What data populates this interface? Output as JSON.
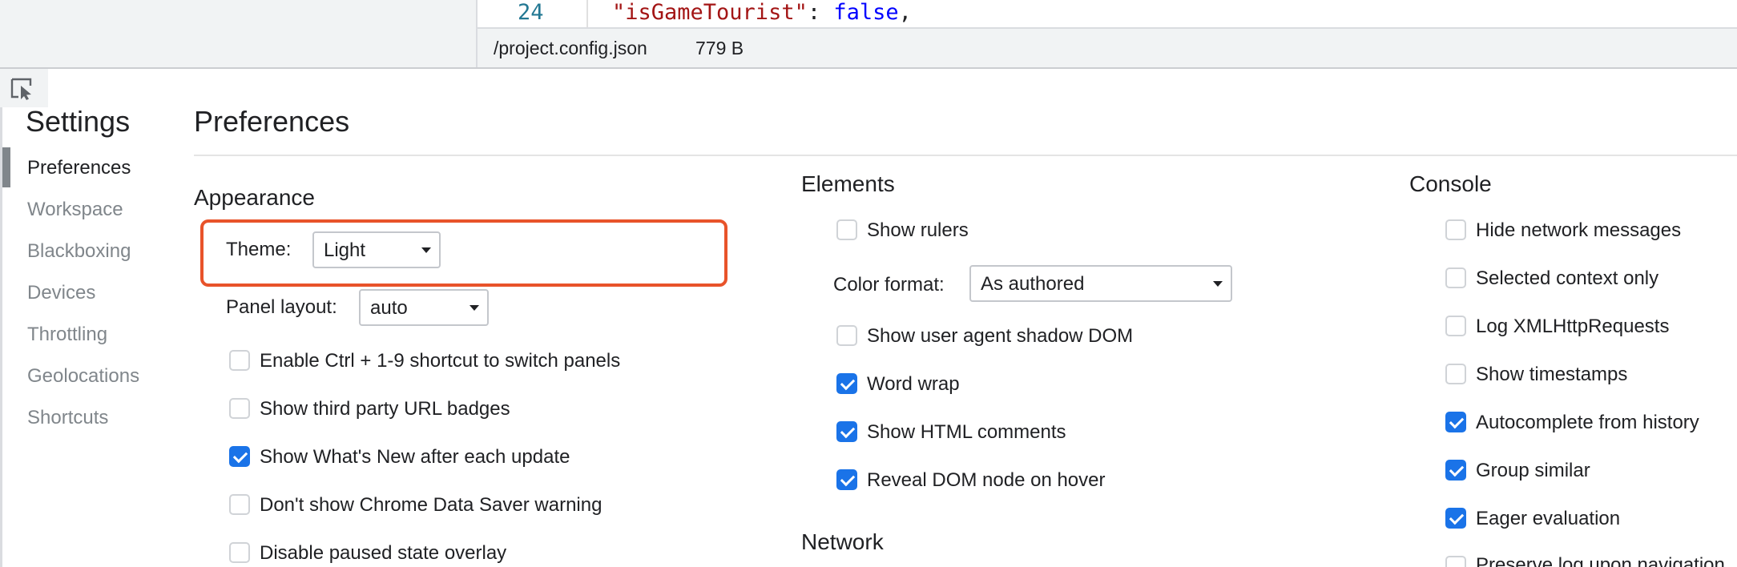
{
  "editor": {
    "line_number": "24",
    "code_key": "\"isGameTourist\"",
    "code_colon": ": ",
    "code_value": "false",
    "code_comma": ",",
    "file_path": "/project.config.json",
    "file_size": "779 B"
  },
  "sidebar": {
    "title": "Settings",
    "items": [
      {
        "label": "Preferences",
        "active": true
      },
      {
        "label": "Workspace",
        "active": false
      },
      {
        "label": "Blackboxing",
        "active": false
      },
      {
        "label": "Devices",
        "active": false
      },
      {
        "label": "Throttling",
        "active": false
      },
      {
        "label": "Geolocations",
        "active": false
      },
      {
        "label": "Shortcuts",
        "active": false
      }
    ]
  },
  "main": {
    "title": "Preferences",
    "appearance": {
      "title": "Appearance",
      "theme_label": "Theme:",
      "theme_value": "Light",
      "panel_layout_label": "Panel layout:",
      "panel_layout_value": "auto",
      "checkboxes": [
        {
          "label": "Enable Ctrl + 1-9 shortcut to switch panels",
          "checked": false
        },
        {
          "label": "Show third party URL badges",
          "checked": false
        },
        {
          "label": "Show What's New after each update",
          "checked": true
        },
        {
          "label": "Don't show Chrome Data Saver warning",
          "checked": false
        },
        {
          "label": "Disable paused state overlay",
          "checked": false
        }
      ]
    },
    "elements": {
      "title": "Elements",
      "show_rulers": {
        "label": "Show rulers",
        "checked": false
      },
      "color_format_label": "Color format:",
      "color_format_value": "As authored",
      "checkboxes": [
        {
          "label": "Show user agent shadow DOM",
          "checked": false
        },
        {
          "label": "Word wrap",
          "checked": true
        },
        {
          "label": "Show HTML comments",
          "checked": true
        },
        {
          "label": "Reveal DOM node on hover",
          "checked": true
        }
      ]
    },
    "network": {
      "title": "Network"
    },
    "console": {
      "title": "Console",
      "checkboxes": [
        {
          "label": "Hide network messages",
          "checked": false
        },
        {
          "label": "Selected context only",
          "checked": false
        },
        {
          "label": "Log XMLHttpRequests",
          "checked": false
        },
        {
          "label": "Show timestamps",
          "checked": false
        },
        {
          "label": "Autocomplete from history",
          "checked": true
        },
        {
          "label": "Group similar",
          "checked": true
        },
        {
          "label": "Eager evaluation",
          "checked": true
        },
        {
          "label": "Preserve log upon navigation",
          "checked": false
        }
      ]
    }
  },
  "colors": {
    "accent": "#1a73e8",
    "highlight": "#e8532a"
  },
  "icons": {
    "inspect": "inspect-element-icon"
  }
}
